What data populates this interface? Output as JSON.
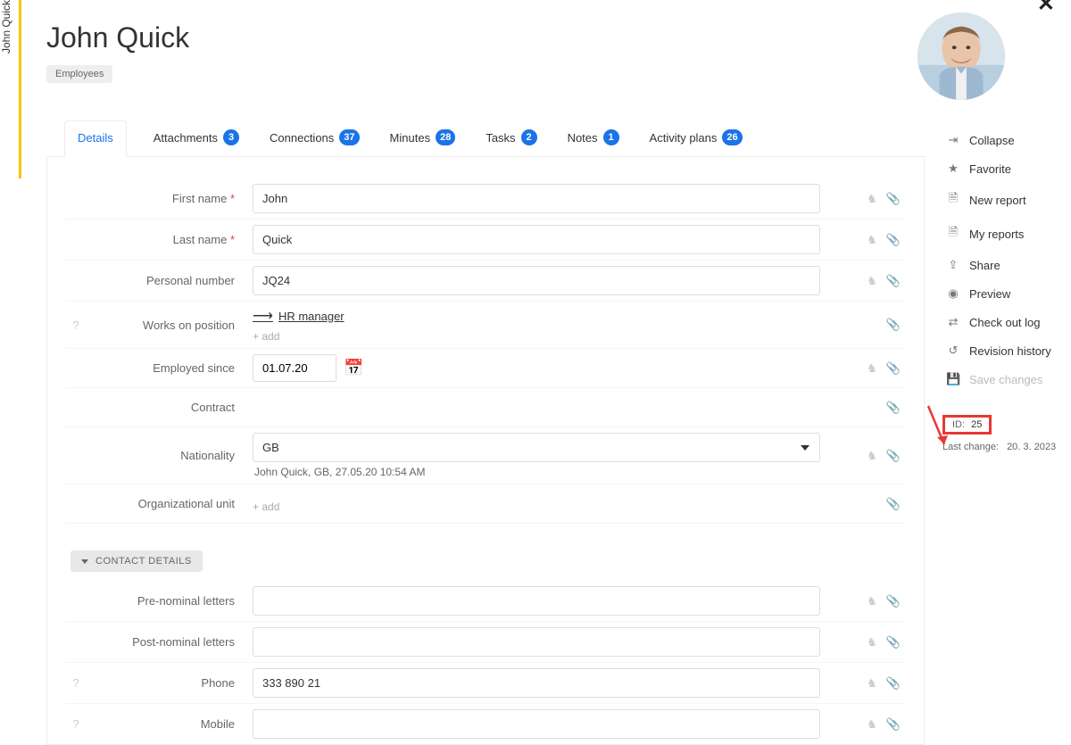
{
  "verticalTab": "John Quick",
  "header": {
    "title": "John Quick",
    "tag": "Employees"
  },
  "tabs": [
    {
      "label": "Details",
      "badge": null,
      "active": true
    },
    {
      "label": "Attachments",
      "badge": "3",
      "active": false
    },
    {
      "label": "Connections",
      "badge": "37",
      "active": false
    },
    {
      "label": "Minutes",
      "badge": "28",
      "active": false
    },
    {
      "label": "Tasks",
      "badge": "2",
      "active": false
    },
    {
      "label": "Notes",
      "badge": "1",
      "active": false
    },
    {
      "label": "Activity plans",
      "badge": "26",
      "active": false
    }
  ],
  "fields": {
    "first_name": {
      "label": "First name",
      "value": "John",
      "required": true
    },
    "last_name": {
      "label": "Last name",
      "value": "Quick",
      "required": true
    },
    "personal_number": {
      "label": "Personal number",
      "value": "JQ24"
    },
    "works_on_position": {
      "label": "Works on position",
      "link": "HR manager",
      "add": "+ add"
    },
    "employed_since": {
      "label": "Employed since",
      "value": "01.07.20"
    },
    "contract": {
      "label": "Contract"
    },
    "nationality": {
      "label": "Nationality",
      "value": "GB",
      "hint": "John Quick, GB, 27.05.20 10:54 AM"
    },
    "org_unit": {
      "label": "Organizational unit",
      "add": "+ add"
    },
    "pre_nominal": {
      "label": "Pre-nominal letters",
      "value": ""
    },
    "post_nominal": {
      "label": "Post-nominal letters",
      "value": ""
    },
    "phone": {
      "label": "Phone",
      "value": "333 890 21"
    },
    "mobile": {
      "label": "Mobile",
      "value": ""
    }
  },
  "section_contact": "CONTACT DETAILS",
  "sidebar": [
    {
      "icon": "collapse",
      "label": "Collapse"
    },
    {
      "icon": "star",
      "label": "Favorite"
    },
    {
      "icon": "doc-add",
      "label": "New report"
    },
    {
      "icon": "doc",
      "label": "My reports"
    },
    {
      "icon": "share",
      "label": "Share"
    },
    {
      "icon": "eye",
      "label": "Preview"
    },
    {
      "icon": "log",
      "label": "Check out log"
    },
    {
      "icon": "history",
      "label": "Revision history"
    },
    {
      "icon": "save",
      "label": "Save changes",
      "disabled": true
    }
  ],
  "meta": {
    "id_label": "ID:",
    "id_value": "25",
    "lc_label": "Last change:",
    "lc_value": "20. 3. 2023"
  }
}
